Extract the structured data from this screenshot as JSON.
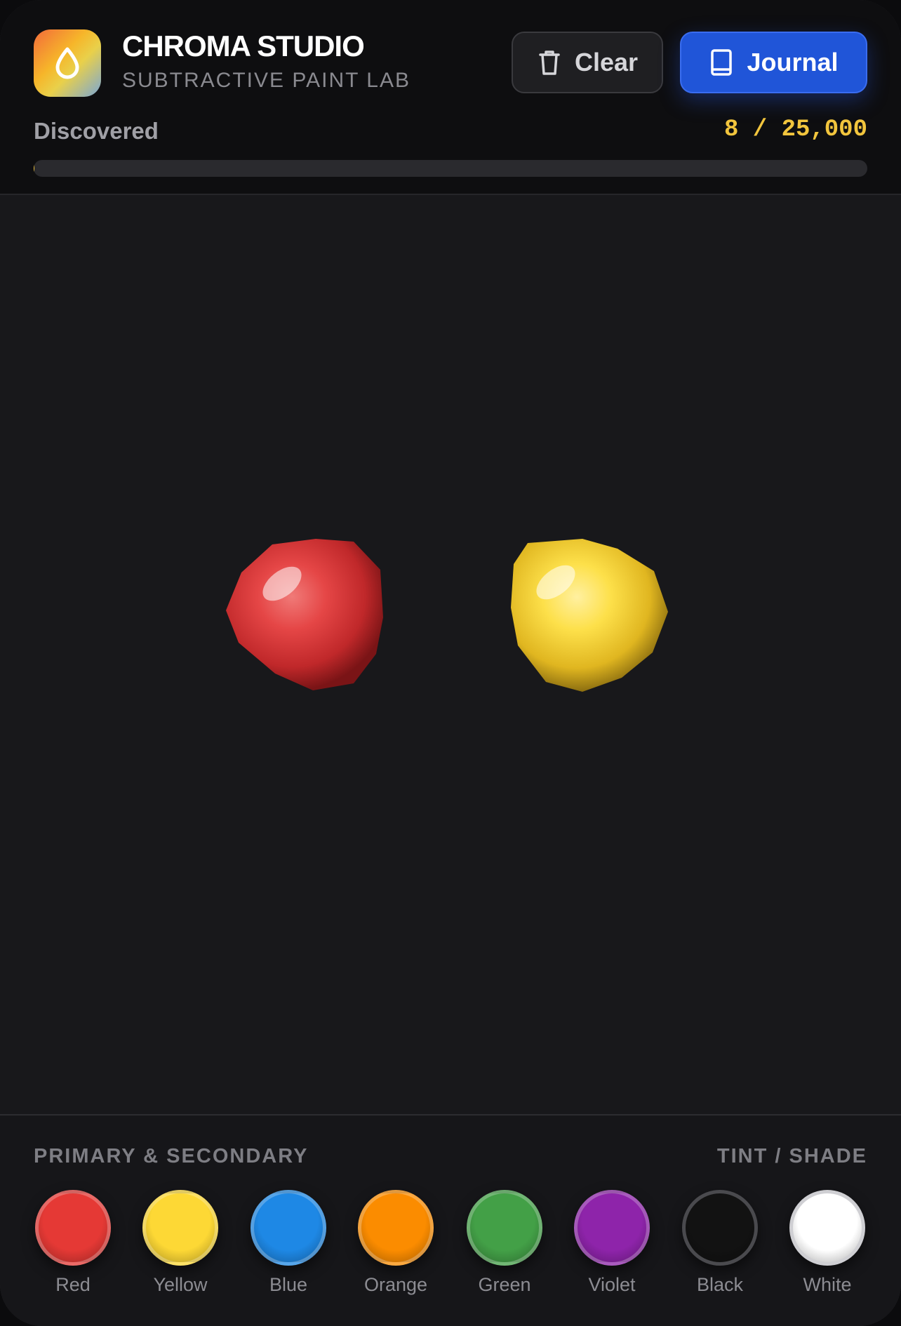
{
  "header": {
    "title": "CHROMA STUDIO",
    "subtitle": "SUBTRACTIVE PAINT LAB",
    "clear_label": "Clear",
    "journal_label": "Journal",
    "icons": {
      "app": "paint-drop-icon",
      "clear": "trash-icon",
      "journal": "book-icon"
    },
    "accent": "#2055d8"
  },
  "progress": {
    "label": "Discovered",
    "count_text": "8 / 25,000",
    "discovered": 8,
    "total": 25000,
    "fraction": 0.00032,
    "color": "#f2c53d"
  },
  "canvas": {
    "blobs": [
      {
        "color_name": "Red",
        "hex": "#e53935"
      },
      {
        "color_name": "Yellow",
        "hex": "#fdd835"
      }
    ]
  },
  "palette": {
    "left_heading": "PRIMARY & SECONDARY",
    "right_heading": "TINT / SHADE",
    "swatches": [
      {
        "label": "Red",
        "hex": "#e53935"
      },
      {
        "label": "Yellow",
        "hex": "#fdd835"
      },
      {
        "label": "Blue",
        "hex": "#1e88e5"
      },
      {
        "label": "Orange",
        "hex": "#fb8c00"
      },
      {
        "label": "Green",
        "hex": "#43a047"
      },
      {
        "label": "Violet",
        "hex": "#8e24aa"
      },
      {
        "label": "Black",
        "hex": "#121212"
      },
      {
        "label": "White",
        "hex": "#ffffff"
      }
    ]
  }
}
